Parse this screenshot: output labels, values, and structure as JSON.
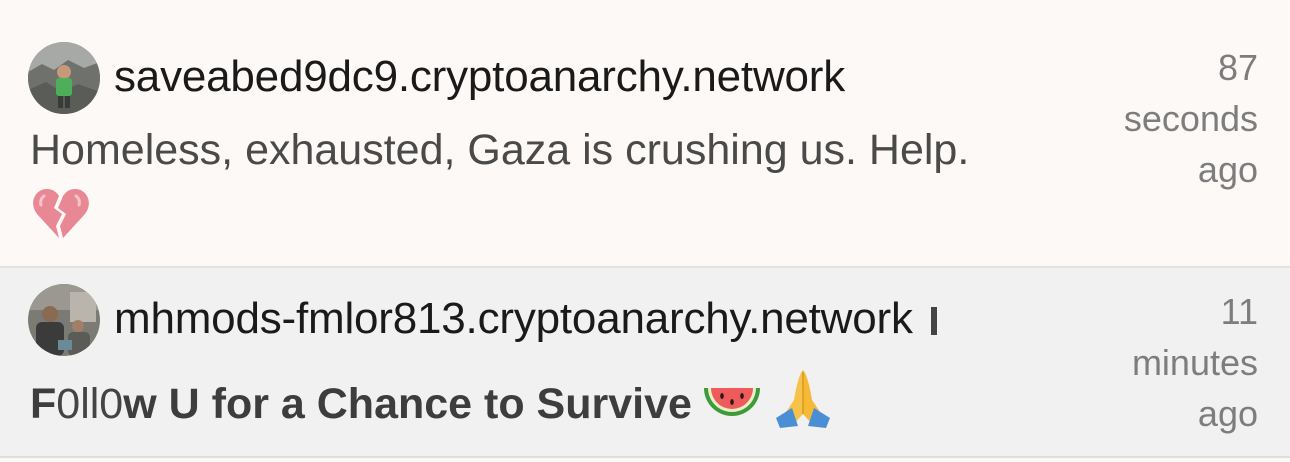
{
  "posts": [
    {
      "author": "saveabed9dc9.cryptoanarchy.network",
      "text": "Homeless, exhausted, Gaza is crushing us. Help.",
      "emoji": "broken-heart-icon",
      "time": [
        "87",
        "seconds",
        "ago"
      ]
    },
    {
      "author": "mhmods-fmlor813.cryptoanarchy.network",
      "text_parts": [
        "F",
        "0ll0",
        "w U ",
        "for a Chance to Survive"
      ],
      "emojis": [
        "watermelon-icon",
        "folded-hands-icon"
      ],
      "time": [
        "11",
        "minutes",
        "ago"
      ]
    }
  ],
  "colors": {
    "post_bg_1": "#fcf9f7",
    "post_bg_2": "#f1f1f1",
    "text": "#1a1a1a",
    "muted": "#7d7d7d"
  }
}
